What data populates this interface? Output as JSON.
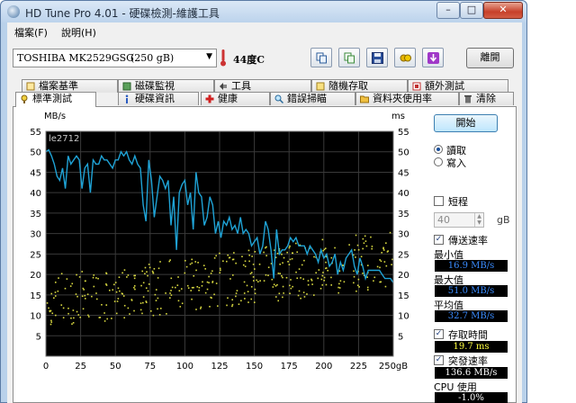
{
  "window": {
    "title": "HD Tune Pro 4.01 - 硬碟檢測-維護工具",
    "minimize_glyph": "–",
    "maximize_glyph": "□",
    "close_glyph": "✕"
  },
  "menu": [
    {
      "label": "檔案(F)"
    },
    {
      "label": "說明(H)"
    }
  ],
  "toolbar": {
    "drive_name": "TOSHIBA MK2529GSG",
    "drive_size": "(250 gB)",
    "temperature": "44度C",
    "exit_label": "離開",
    "icons": [
      "copy-icon",
      "copy-text-icon",
      "save-icon",
      "options-icon",
      "download-icon"
    ]
  },
  "tabs_top": [
    {
      "label": "檔案基準",
      "icon": "file-benchmark-icon"
    },
    {
      "label": "磁碟監視",
      "icon": "disk-monitor-icon"
    },
    {
      "label": "工具",
      "icon": "tools-icon"
    },
    {
      "label": "隨機存取",
      "icon": "random-access-icon"
    },
    {
      "label": "額外測試",
      "icon": "extra-tests-icon"
    }
  ],
  "tabs_bottom": [
    {
      "label": "標準測試",
      "icon": "benchmark-icon",
      "active": true
    },
    {
      "label": "硬碟資訊",
      "icon": "info-icon"
    },
    {
      "label": "健康",
      "icon": "health-icon"
    },
    {
      "label": "錯誤掃瞄",
      "icon": "error-scan-icon"
    },
    {
      "label": "資料夾使用率",
      "icon": "folder-usage-icon"
    },
    {
      "label": "清除",
      "icon": "erase-icon"
    }
  ],
  "side": {
    "start_label": "開始",
    "read_label": "讀取",
    "write_label": "寫入",
    "read_selected": true,
    "short_label": "短程",
    "short_checked": false,
    "short_value": "40",
    "short_unit": "gB",
    "transfer_rate_label": "傳送速率",
    "transfer_rate_checked": true,
    "min_label": "最小值",
    "min_value": "16.9 MB/s",
    "max_label": "最大值",
    "max_value": "51.0 MB/s",
    "avg_label": "平均值",
    "avg_value": "32.7 MB/s",
    "access_time_label": "存取時間",
    "access_time_checked": true,
    "access_time_value": "19.7 ms",
    "burst_rate_label": "突發速率",
    "burst_rate_checked": true,
    "burst_rate_value": "136.6 MB/s",
    "cpu_label": "CPU 使用",
    "cpu_value": "-1.0%"
  },
  "colors": {
    "chart_bg": "#000000",
    "grid": "#3a3a3a",
    "transfer_line": "#1fa3d6",
    "access_dots": "#d8d840",
    "value_blue": "#3a8cff",
    "value_yellow": "#ffff40",
    "value_white": "#ffffff"
  },
  "chart_data": {
    "type": "line",
    "watermark": "le2712",
    "y_left_label": "MB/s",
    "y_right_label": "ms",
    "x_unit_label": "250gB",
    "x_ticks": [
      "0",
      "25",
      "50",
      "75",
      "100",
      "125",
      "150",
      "175",
      "200",
      "225",
      "250gB"
    ],
    "y_ticks": [
      "55",
      "50",
      "45",
      "40",
      "35",
      "30",
      "25",
      "20",
      "15",
      "10",
      "5"
    ],
    "xlim": [
      0,
      250
    ],
    "ylim_left": [
      0,
      55
    ],
    "ylim_right": [
      0,
      55
    ],
    "grid": true,
    "series": [
      {
        "name": "傳送速率",
        "unit": "MB/s",
        "x": [
          0,
          2,
          4,
          6,
          8,
          10,
          12,
          14,
          16,
          18,
          20,
          22,
          24,
          26,
          28,
          30,
          32,
          34,
          36,
          38,
          40,
          42,
          44,
          46,
          48,
          50,
          52,
          54,
          56,
          58,
          60,
          62,
          64,
          66,
          68,
          70,
          72,
          74,
          76,
          78,
          80,
          82,
          84,
          86,
          88,
          90,
          92,
          94,
          96,
          98,
          100,
          102,
          104,
          106,
          108,
          110,
          112,
          114,
          116,
          118,
          120,
          122,
          124,
          126,
          128,
          130,
          132,
          134,
          136,
          138,
          140,
          142,
          144,
          146,
          148,
          150,
          152,
          154,
          156,
          158,
          160,
          162,
          164,
          166,
          168,
          170,
          172,
          174,
          176,
          178,
          180,
          182,
          184,
          186,
          188,
          190,
          192,
          194,
          196,
          198,
          200,
          202,
          204,
          206,
          208,
          210,
          212,
          214,
          216,
          218,
          220,
          222,
          224,
          226,
          228,
          230,
          232,
          234,
          236,
          238,
          240,
          242,
          244,
          246,
          248,
          250
        ],
        "values": [
          50,
          50.5,
          49,
          47,
          44,
          43,
          46,
          41,
          49,
          47,
          48,
          49,
          48,
          41,
          46,
          47,
          40,
          48,
          47,
          47,
          49,
          48,
          48,
          47,
          46,
          48,
          48,
          50,
          49,
          50,
          48,
          47,
          49,
          47,
          46,
          37,
          33,
          48,
          43,
          34,
          39,
          44,
          43,
          41,
          43,
          32,
          39,
          26,
          40,
          42,
          43,
          37,
          40,
          31,
          45,
          40,
          39,
          32,
          34,
          39,
          37,
          30,
          33,
          29,
          33,
          32,
          34,
          31,
          32,
          30,
          34,
          30,
          31,
          30,
          27,
          28,
          29,
          25,
          27,
          33,
          31,
          26,
          19,
          31,
          25,
          26,
          26,
          27,
          29,
          28,
          29,
          27,
          27,
          27,
          25,
          27,
          26,
          25,
          23,
          26,
          24,
          25,
          22,
          23,
          25,
          20,
          23,
          21,
          24,
          25,
          26,
          22,
          20,
          24,
          22,
          19,
          21,
          21,
          21,
          21,
          21,
          20,
          19,
          19,
          19,
          18
        ]
      },
      {
        "name": "存取時間",
        "unit": "ms",
        "type": "scatter",
        "approx_points": 420,
        "x_range": [
          0,
          250
        ],
        "values_trend_start": [
          7,
          20
        ],
        "values_trend_end": [
          17,
          31
        ]
      }
    ]
  }
}
